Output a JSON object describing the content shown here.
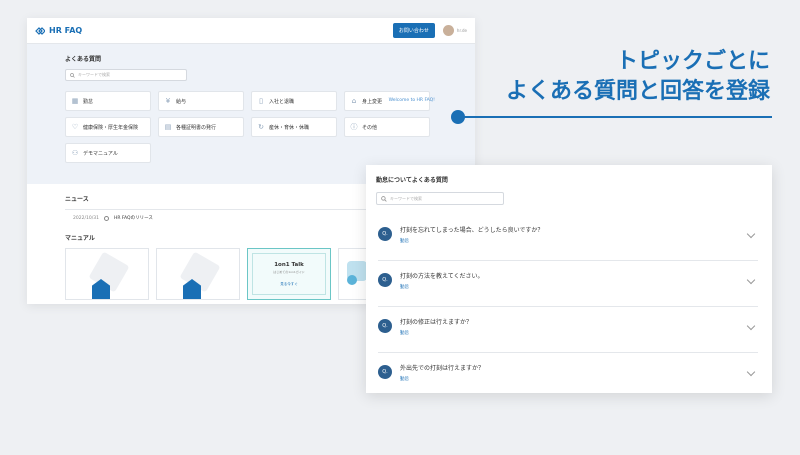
{
  "app": {
    "logo_text": "HR FAQ",
    "contact_button": "お問い合わせ",
    "user_name": "hr.de",
    "faq_title": "よくある質問",
    "search_placeholder": "キーワードで検索",
    "welcome": "Welcome to HR FAQ!",
    "categories": [
      {
        "label": "勤怠",
        "icon": "calendar-icon"
      },
      {
        "label": "給与",
        "icon": "coin-icon"
      },
      {
        "label": "入社と退職",
        "icon": "door-icon"
      },
      {
        "label": "身上変更",
        "icon": "house-icon"
      },
      {
        "label": "健康保険・厚生年金保険",
        "icon": "heart-icon"
      },
      {
        "label": "各種証明書の発行",
        "icon": "document-icon"
      },
      {
        "label": "産休・育休・休職",
        "icon": "refresh-icon"
      },
      {
        "label": "その他",
        "icon": "info-icon"
      },
      {
        "label": "デモマニュアル",
        "icon": "group-icon"
      }
    ],
    "news_title": "ニュース",
    "news": [
      {
        "date": "2022/10/31",
        "text": "HR FAQのリリース"
      }
    ],
    "manual_title": "マニュアル",
    "manual_talk": {
      "title": "1on1 Talk",
      "subtitle": "はじめての1on1ガイド",
      "link": "見る今すぐ"
    }
  },
  "panel": {
    "title": "勤怠についてよくある質問",
    "search_placeholder": "キーワードで検索",
    "badge": "Q.",
    "questions": [
      {
        "q": "打刻を忘れてしまった場合、どうしたら良いですか？",
        "tag": "勤怠"
      },
      {
        "q": "打刻の方法を教えてください。",
        "tag": "勤怠"
      },
      {
        "q": "打刻の修正は行えますか？",
        "tag": "勤怠"
      },
      {
        "q": "外出先での打刻は行えますか？",
        "tag": "勤怠"
      }
    ]
  },
  "headline": {
    "line1": "トピックごとに",
    "line2": "よくある質問と回答を登録"
  },
  "colors": {
    "accent": "#1a6fb5",
    "badge": "#2d5f8f"
  }
}
